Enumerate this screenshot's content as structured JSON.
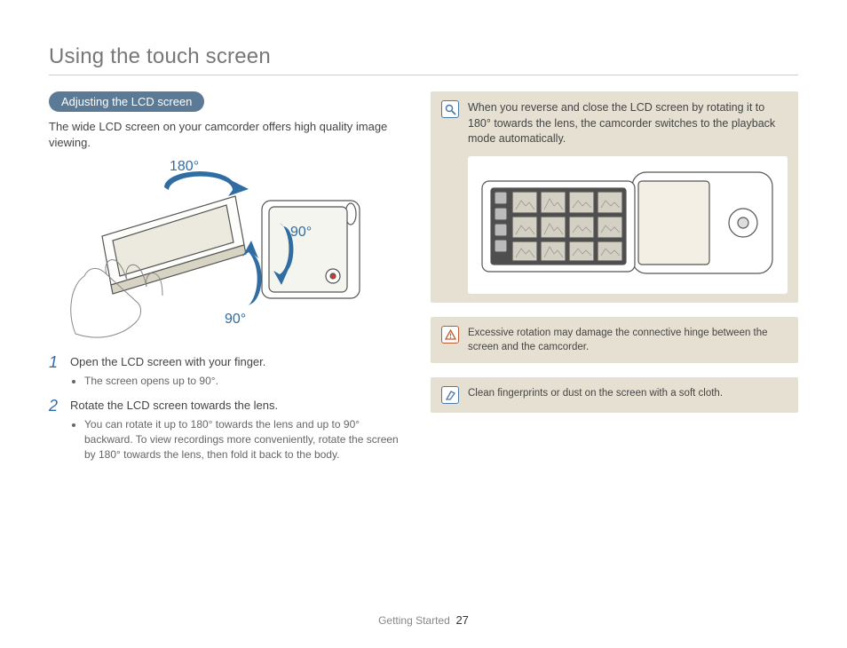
{
  "title": "Using the touch screen",
  "subheading": "Adjusting the LCD screen",
  "intro": "The wide LCD screen on your camcorder offers high quality image viewing.",
  "angles": {
    "top": "180°",
    "right": "90°",
    "bottom": "90°"
  },
  "steps": [
    {
      "num": "1",
      "title": "Open the LCD screen with your finger.",
      "bullets": [
        "The screen opens up to 90°."
      ]
    },
    {
      "num": "2",
      "title": "Rotate the LCD screen towards the lens.",
      "bullets": [
        "You can rotate it up to 180° towards the lens and up to 90° backward. To view recordings more conveniently, rotate the screen by 180° towards the lens, then fold it back to the body."
      ]
    }
  ],
  "info_note": "When you reverse and close the LCD screen by rotating it to 180° towards the lens, the camcorder switches to the playback mode automatically.",
  "warn_note": "Excessive rotation may damage the connective hinge between the screen and the camcorder.",
  "clean_note": "Clean fingerprints or dust on the screen with a soft cloth.",
  "footer_section": "Getting Started",
  "page_number": "27"
}
